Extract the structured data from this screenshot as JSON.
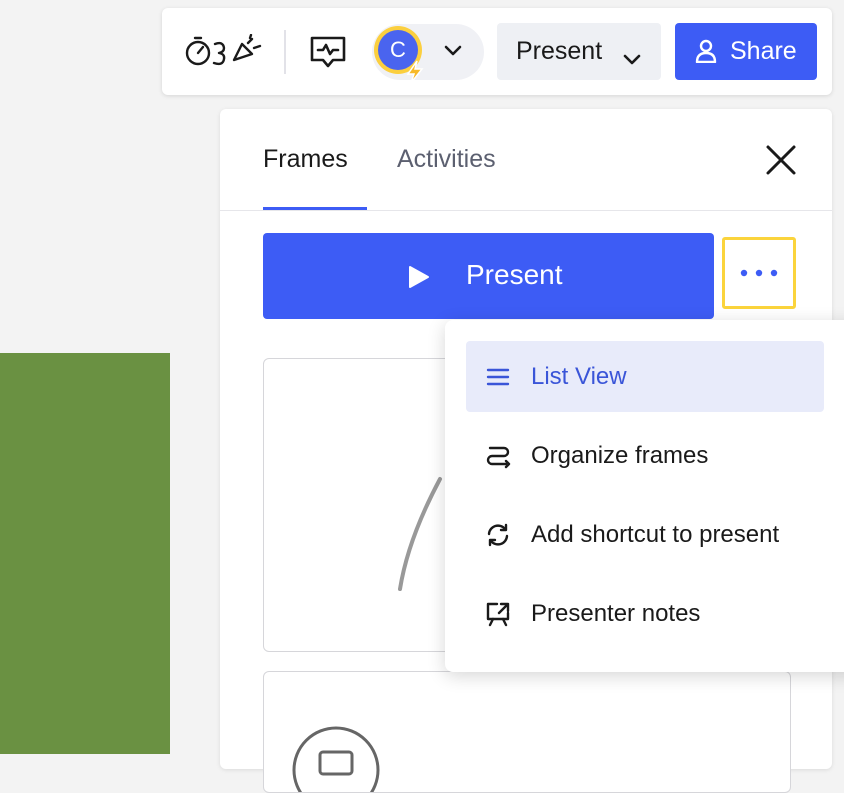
{
  "toolbar": {
    "user_initial": "C",
    "present_label": "Present",
    "share_label": "Share"
  },
  "panel": {
    "tabs": [
      {
        "label": "Frames",
        "active": true
      },
      {
        "label": "Activities",
        "active": false
      }
    ],
    "present_button_label": "Present"
  },
  "menu": {
    "items": [
      {
        "label": "List View",
        "icon": "list-icon",
        "active": true
      },
      {
        "label": "Organize frames",
        "icon": "organize-icon",
        "active": false
      },
      {
        "label": "Add shortcut to present",
        "icon": "shortcut-icon",
        "active": false
      },
      {
        "label": "Presenter notes",
        "icon": "presenter-notes-icon",
        "active": false
      }
    ]
  },
  "colors": {
    "accent": "#3d5cf5",
    "highlight_border": "#fbd43c",
    "canvas_shape": "#6a9142",
    "menu_active_bg": "#e8ebfa"
  }
}
